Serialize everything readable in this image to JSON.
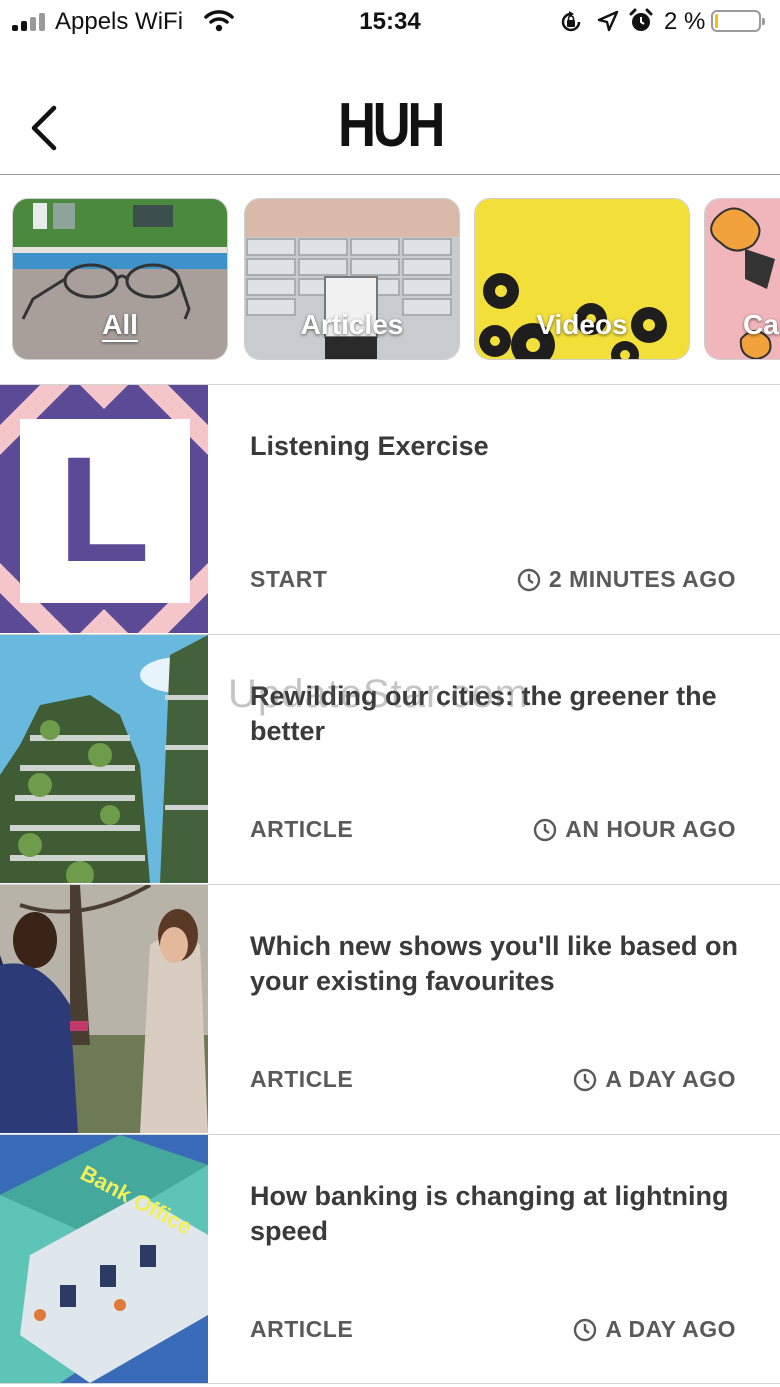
{
  "status_bar": {
    "carrier": "Appels WiFi",
    "time": "15:34",
    "battery_percent": "2 %",
    "battery_level": 0.02,
    "icons": [
      "signal-icon",
      "wifi-icon",
      "rotation-lock-icon",
      "location-icon",
      "alarm-icon",
      "battery-icon"
    ]
  },
  "header": {
    "logo": "HUH",
    "back_icon": "chevron-left-icon"
  },
  "categories": [
    {
      "label": "All",
      "active": true
    },
    {
      "label": "Articles",
      "active": false
    },
    {
      "label": "Videos",
      "active": false
    },
    {
      "label": "Ca",
      "active": false
    }
  ],
  "feed": [
    {
      "title": "Listening Exercise",
      "type": "START",
      "time": "2 MINUTES AGO"
    },
    {
      "title": "Rewilding our cities: the greener the better",
      "type": "ARTICLE",
      "time": "AN HOUR AGO"
    },
    {
      "title": "Which new shows you'll like based on your existing favourites",
      "type": "ARTICLE",
      "time": "A DAY AGO"
    },
    {
      "title": "How banking is changing at lightning speed",
      "type": "ARTICLE",
      "time": "A DAY AGO"
    }
  ],
  "thumbnails": {
    "listening_letter": "L",
    "bank_sign": "Bank Office"
  },
  "watermark": "UpdateStar.com",
  "colors": {
    "accent_purple": "#5b4a96",
    "pink": "#f4c6c9",
    "yellow": "#f4e04a"
  }
}
